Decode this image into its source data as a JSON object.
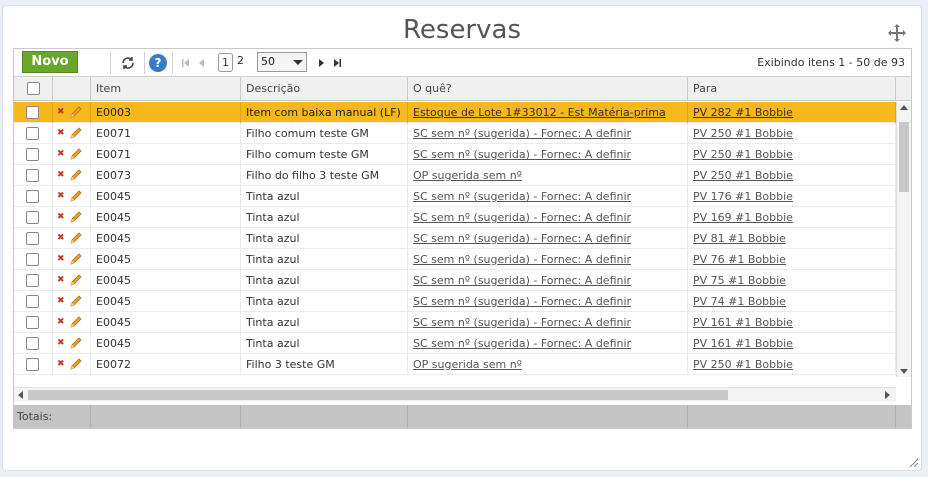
{
  "page": {
    "title": "Reservas"
  },
  "toolbar": {
    "new_label": "Novo",
    "pages": [
      "1",
      "2"
    ],
    "page_size": "50",
    "info": "Exibindo itens 1 - 50 de 93",
    "help_label": "?"
  },
  "columns": {
    "item": "Item",
    "descricao": "Descrição",
    "oque": "O quê?",
    "para": "Para"
  },
  "rows": [
    {
      "item": "E0003",
      "descricao": "Item com baixa manual (LF)",
      "oque": "Estoque de Lote 1#33012 - Est Matéria-prima",
      "para": "PV 282 #1 Bobbie",
      "selected": true
    },
    {
      "item": "E0071",
      "descricao": "Filho comum teste GM",
      "oque": "SC sem nº (sugerida) - Fornec: A definir",
      "para": "PV 250 #1 Bobbie",
      "selected": false
    },
    {
      "item": "E0071",
      "descricao": "Filho comum teste GM",
      "oque": "SC sem nº (sugerida) - Fornec: A definir",
      "para": "PV 250 #1 Bobbie",
      "selected": false
    },
    {
      "item": "E0073",
      "descricao": "Filho do filho 3 teste GM",
      "oque": "OP sugerida sem nº",
      "para": "PV 250 #1 Bobbie",
      "selected": false
    },
    {
      "item": "E0045",
      "descricao": "Tinta azul",
      "oque": "SC sem nº (sugerida) - Fornec: A definir",
      "para": "PV 176 #1 Bobbie",
      "selected": false
    },
    {
      "item": "E0045",
      "descricao": "Tinta azul",
      "oque": "SC sem nº (sugerida) - Fornec: A definir",
      "para": "PV 169 #1 Bobbie",
      "selected": false
    },
    {
      "item": "E0045",
      "descricao": "Tinta azul",
      "oque": "SC sem nº (sugerida) - Fornec: A definir",
      "para": "PV 81 #1 Bobbie",
      "selected": false
    },
    {
      "item": "E0045",
      "descricao": "Tinta azul",
      "oque": "SC sem nº (sugerida) - Fornec: A definir",
      "para": "PV 76 #1 Bobbie",
      "selected": false
    },
    {
      "item": "E0045",
      "descricao": "Tinta azul",
      "oque": "SC sem nº (sugerida) - Fornec: A definir",
      "para": "PV 75 #1 Bobbie",
      "selected": false
    },
    {
      "item": "E0045",
      "descricao": "Tinta azul",
      "oque": "SC sem nº (sugerida) - Fornec: A definir",
      "para": "PV 74 #1 Bobbie",
      "selected": false
    },
    {
      "item": "E0045",
      "descricao": "Tinta azul",
      "oque": "SC sem nº (sugerida) - Fornec: A definir",
      "para": "PV 161 #1 Bobbie",
      "selected": false
    },
    {
      "item": "E0045",
      "descricao": "Tinta azul",
      "oque": "SC sem nº (sugerida) - Fornec: A definir",
      "para": "PV 161 #1 Bobbie",
      "selected": false
    },
    {
      "item": "E0072",
      "descricao": "Filho 3 teste GM",
      "oque": "OP sugerida sem nº",
      "para": "PV 250 #1 Bobbie",
      "selected": false
    }
  ],
  "footer": {
    "totals_label": "Totais:"
  },
  "colors": {
    "accent_green": "#6aa52c",
    "selected_row": "#f6b81b",
    "delete_red": "#c0392b",
    "edit_orange": "#e08a1e",
    "help_blue": "#3a7bc8"
  },
  "icons": [
    "move-icon",
    "refresh-icon",
    "help-icon",
    "first-page-icon",
    "prev-page-icon",
    "next-page-icon",
    "last-page-icon",
    "delete-icon",
    "edit-icon",
    "resize-grip-icon"
  ]
}
